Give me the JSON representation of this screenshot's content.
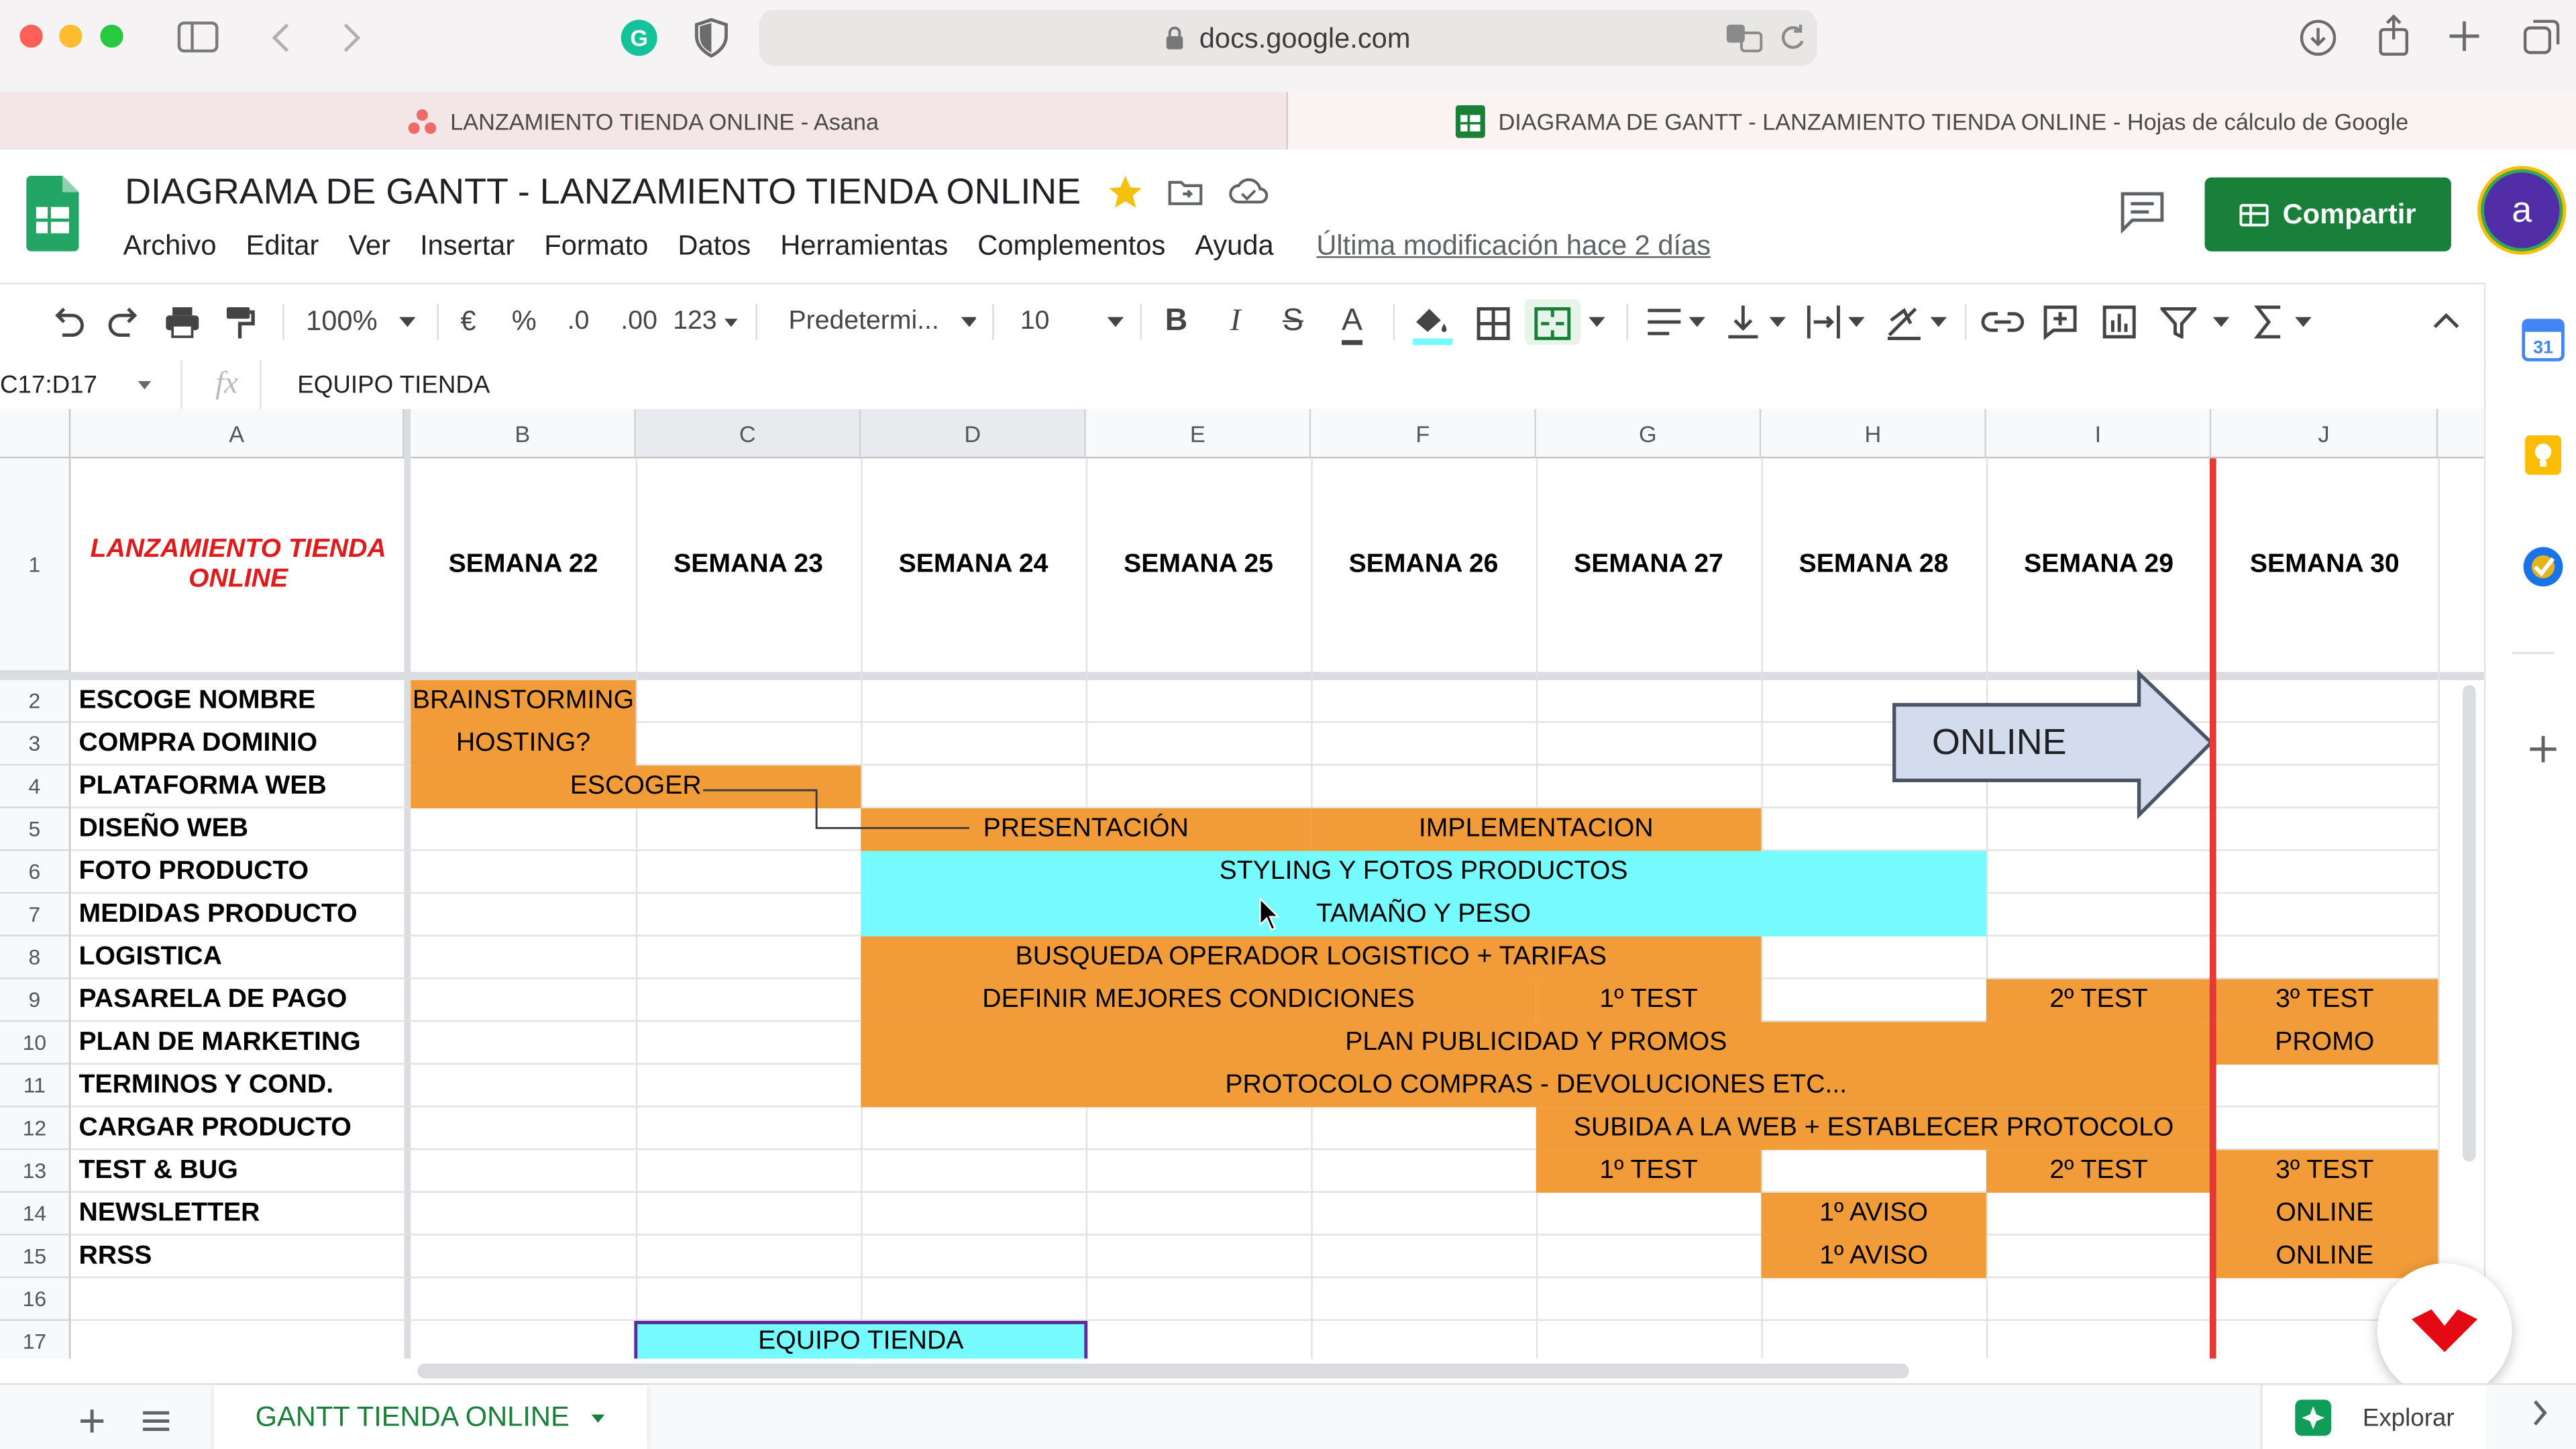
{
  "browser": {
    "url": "docs.google.com",
    "tabs": [
      {
        "label": "LANZAMIENTO TIENDA ONLINE - Asana"
      },
      {
        "label": "DIAGRAMA DE GANTT - LANZAMIENTO TIENDA ONLINE - Hojas de cálculo de Google"
      }
    ]
  },
  "doc": {
    "title": "DIAGRAMA DE GANTT - LANZAMIENTO TIENDA ONLINE",
    "menu": [
      "Archivo",
      "Editar",
      "Ver",
      "Insertar",
      "Formato",
      "Datos",
      "Herramientas",
      "Complementos",
      "Ayuda"
    ],
    "last_edit": "Última modificación hace 2 días",
    "share_label": "Compartir",
    "avatar_letter": "a"
  },
  "toolbar": {
    "zoom": "100%",
    "currency": "€",
    "percent": "%",
    "dec_less": ".0",
    "dec_more": ".00",
    "format_more": "123",
    "font": "Predetermi...",
    "font_size": "10",
    "bold": "B",
    "italic": "I",
    "strike": "S",
    "text_color": "A"
  },
  "formula_bar": {
    "name_box": "C17:D17",
    "fx": "fx",
    "content": "EQUIPO TIENDA"
  },
  "sheet": {
    "columns": [
      "A",
      "B",
      "C",
      "D",
      "E",
      "F",
      "G",
      "H",
      "I",
      "J"
    ],
    "row_numbers": [
      "1",
      "2",
      "3",
      "4",
      "5",
      "6",
      "7",
      "8",
      "9",
      "10",
      "11",
      "12",
      "13",
      "14",
      "15",
      "16",
      "17"
    ],
    "title_cell": "LANZAMIENTO TIENDA ONLINE",
    "weeks": [
      "SEMANA 22",
      "SEMANA 23",
      "SEMANA 24",
      "SEMANA 25",
      "SEMANA 26",
      "SEMANA 27",
      "SEMANA 28",
      "SEMANA 29",
      "SEMANA 30"
    ],
    "tasks": [
      "ESCOGE NOMBRE",
      "COMPRA DOMINIO",
      "PLATAFORMA WEB",
      "DISEÑO WEB",
      "FOTO PRODUCTO",
      "MEDIDAS PRODUCTO",
      "LOGISTICA",
      "PASARELA DE PAGO",
      "PLAN DE MARKETING",
      "TERMINOS Y COND.",
      "CARGAR PRODUCTO",
      "TEST & BUG",
      "NEWSLETTER",
      "RRSS"
    ],
    "bars": [
      {
        "row": 2,
        "start": 1,
        "span": 1,
        "color": "orange",
        "text": "BRAINSTORMING"
      },
      {
        "row": 3,
        "start": 1,
        "span": 1,
        "color": "orange",
        "text": "HOSTING?"
      },
      {
        "row": 4,
        "start": 1,
        "span": 2,
        "color": "orange",
        "text": "ESCOGER"
      },
      {
        "row": 5,
        "start": 3,
        "span": 2,
        "color": "orange",
        "text": "PRESENTACIÓN"
      },
      {
        "row": 5,
        "start": 5,
        "span": 2,
        "color": "orange",
        "text": "IMPLEMENTACION"
      },
      {
        "row": 6,
        "start": 3,
        "span": 5,
        "color": "cyan",
        "text": "STYLING Y FOTOS PRODUCTOS"
      },
      {
        "row": 7,
        "start": 3,
        "span": 5,
        "color": "cyan",
        "text": "TAMAÑO Y PESO"
      },
      {
        "row": 8,
        "start": 3,
        "span": 4,
        "color": "orange",
        "text": "BUSQUEDA OPERADOR LOGISTICO + TARIFAS"
      },
      {
        "row": 9,
        "start": 3,
        "span": 3,
        "color": "orange",
        "text": "DEFINIR MEJORES CONDICIONES"
      },
      {
        "row": 9,
        "start": 6,
        "span": 1,
        "color": "orange",
        "text": "1º TEST"
      },
      {
        "row": 9,
        "start": 8,
        "span": 1,
        "color": "orange",
        "text": "2º TEST"
      },
      {
        "row": 9,
        "start": 9,
        "span": 1,
        "color": "orange",
        "text": "3º TEST"
      },
      {
        "row": 10,
        "start": 3,
        "span": 6,
        "color": "orange",
        "text": "PLAN PUBLICIDAD Y PROMOS"
      },
      {
        "row": 10,
        "start": 9,
        "span": 1,
        "color": "orange",
        "text": "PROMO"
      },
      {
        "row": 11,
        "start": 3,
        "span": 6,
        "color": "orange",
        "text": "PROTOCOLO COMPRAS - DEVOLUCIONES ETC..."
      },
      {
        "row": 12,
        "start": 6,
        "span": 3,
        "color": "orange",
        "text": "SUBIDA A LA WEB + ESTABLECER PROTOCOLO"
      },
      {
        "row": 13,
        "start": 6,
        "span": 1,
        "color": "orange",
        "text": "1º TEST"
      },
      {
        "row": 13,
        "start": 8,
        "span": 1,
        "color": "orange",
        "text": "2º TEST"
      },
      {
        "row": 13,
        "start": 9,
        "span": 1,
        "color": "orange",
        "text": "3º TEST"
      },
      {
        "row": 14,
        "start": 7,
        "span": 1,
        "color": "orange",
        "text": "1º AVISO"
      },
      {
        "row": 14,
        "start": 9,
        "span": 1,
        "color": "orange",
        "text": "ONLINE"
      },
      {
        "row": 15,
        "start": 7,
        "span": 1,
        "color": "orange",
        "text": "1º AVISO"
      },
      {
        "row": 15,
        "start": 9,
        "span": 1,
        "color": "orange",
        "text": "ONLINE"
      },
      {
        "row": 17,
        "start": 2,
        "span": 2,
        "color": "cyan",
        "text": "EQUIPO TIENDA"
      }
    ],
    "arrow_label": "ONLINE"
  },
  "bottom": {
    "sheet_tab": "GANTT TIENDA ONLINE",
    "explore": "Explorar"
  },
  "colors": {
    "orange": "#f19c38",
    "cyan": "#75fbfd",
    "green": "#188038",
    "title_red": "#e01b1b",
    "deadline": "#e53935"
  }
}
